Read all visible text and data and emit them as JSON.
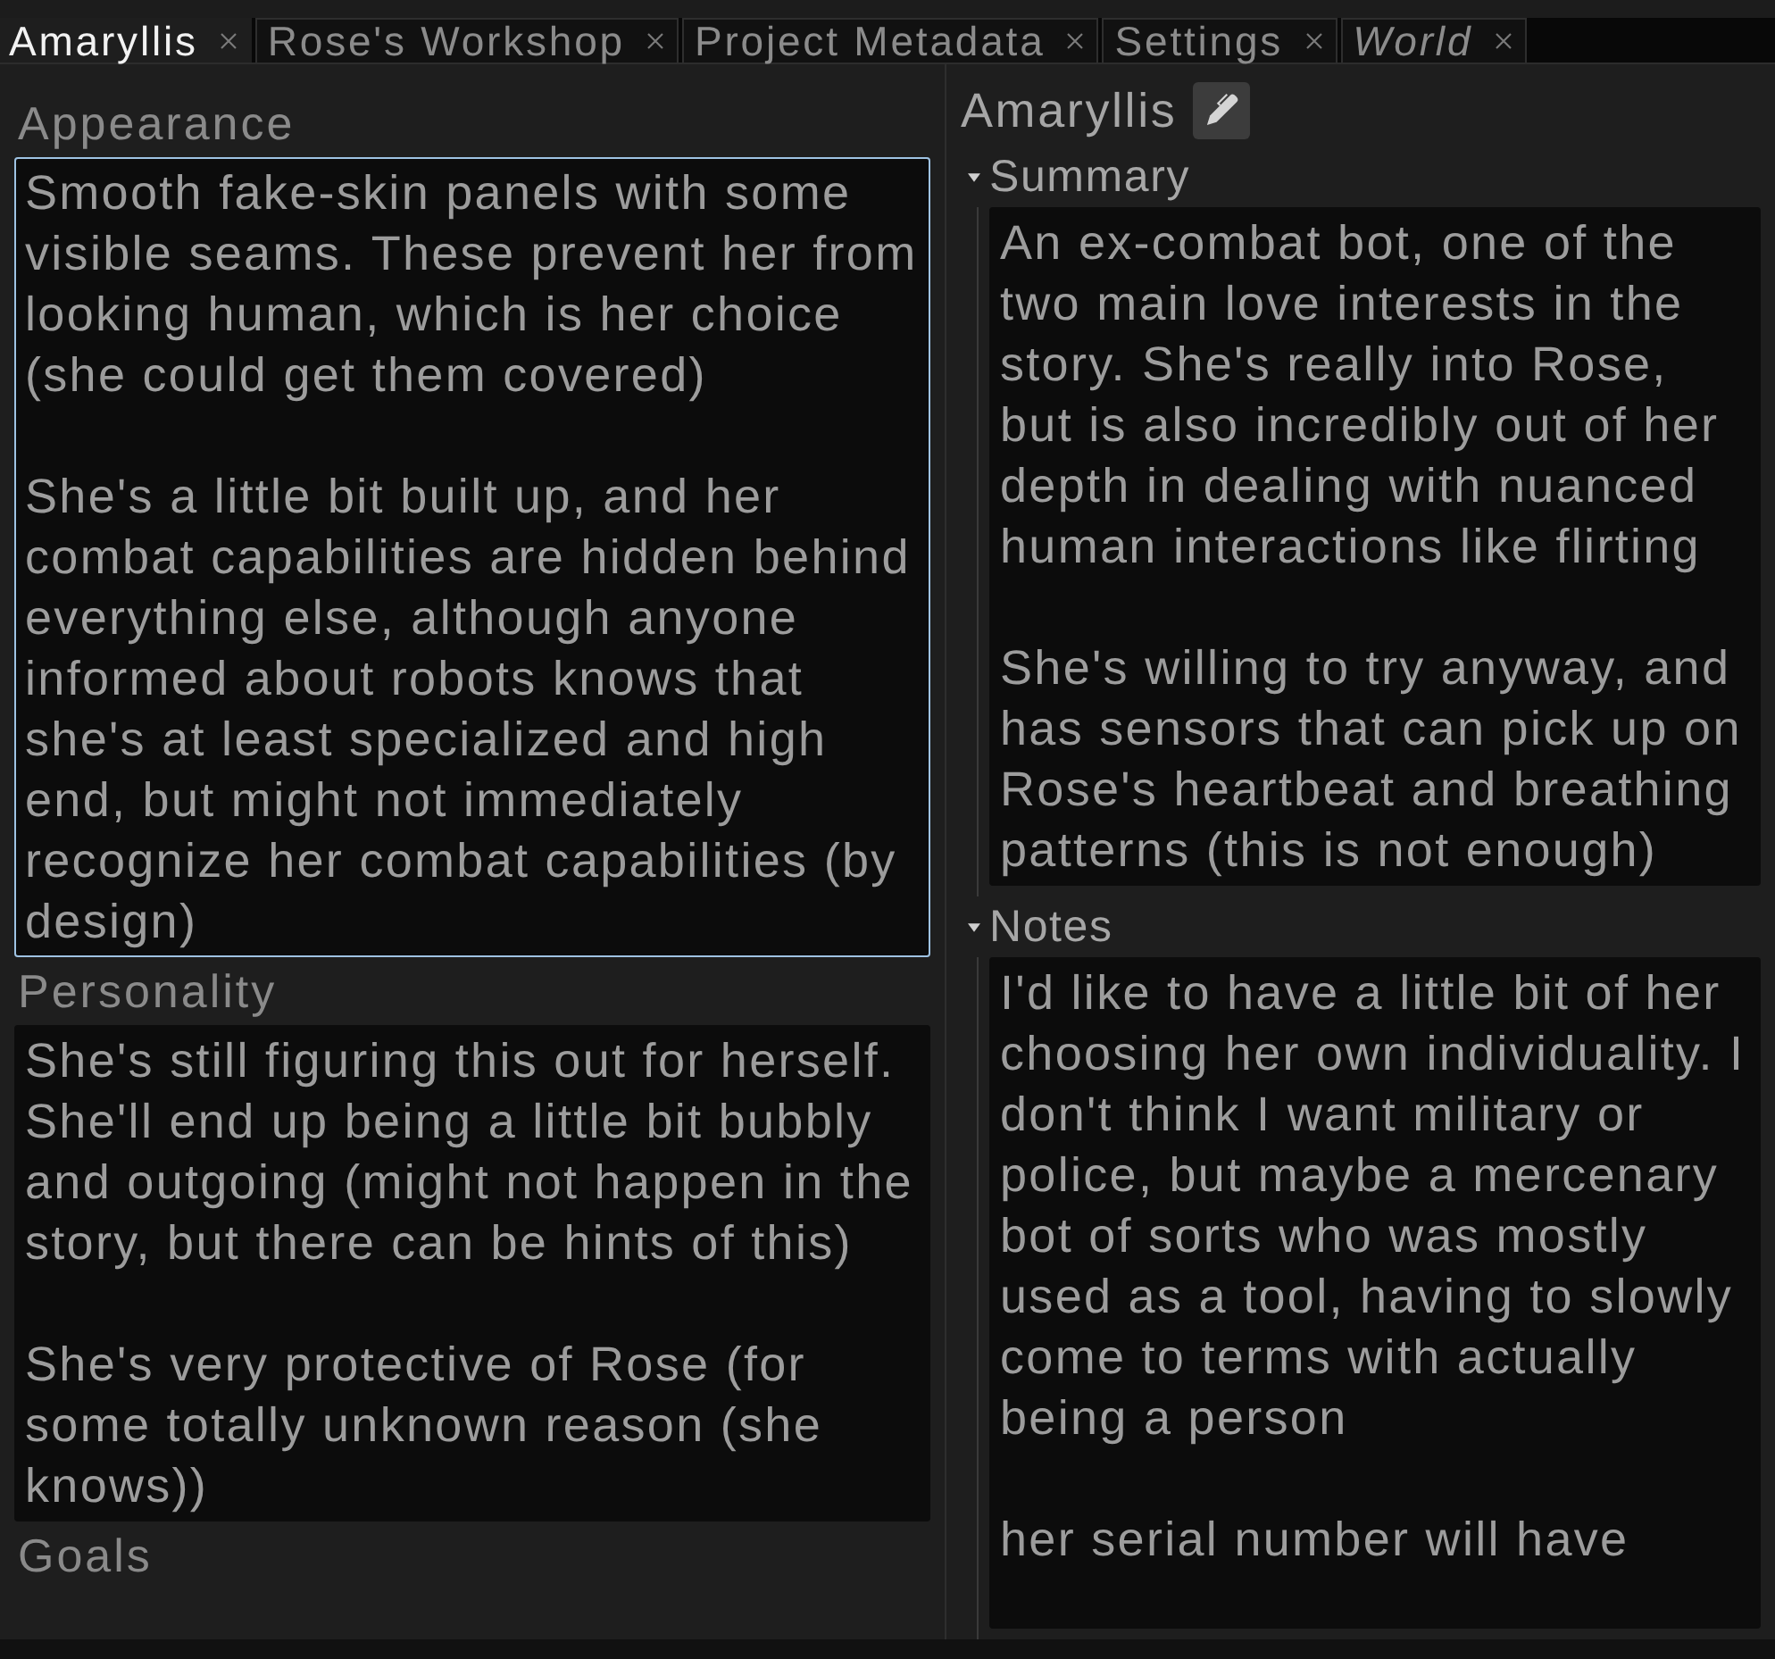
{
  "tabs": [
    {
      "label": "Amaryllis",
      "selected": true,
      "italic": false
    },
    {
      "label": "Rose's Workshop",
      "selected": false,
      "italic": false
    },
    {
      "label": "Project Metadata",
      "selected": false,
      "italic": false
    },
    {
      "label": "Settings",
      "selected": false,
      "italic": false
    },
    {
      "label": "World",
      "selected": false,
      "italic": true
    }
  ],
  "left_panel": {
    "fields": [
      {
        "label": "Appearance",
        "focused": true,
        "value": "Smooth fake-skin panels with some visible seams. These prevent her from looking human, which is her choice (she could get them covered)\n\nShe's a little bit built up, and her combat capabilities are hidden behind everything else, although anyone informed about robots knows that she's at least specialized and high end, but might not immediately recognize her combat capabilities (by design)"
      },
      {
        "label": "Personality",
        "focused": false,
        "value": "She's still figuring this out for herself. She'll end up being a little bit bubbly and outgoing (might not happen in the story, but there can be hints of this)\n\nShe's very protective of Rose (for some totally unknown reason (she knows))"
      },
      {
        "label": "Goals"
      }
    ]
  },
  "right_panel": {
    "title": "Amaryllis",
    "sections": [
      {
        "label": "Summary",
        "expanded": true,
        "value": "An ex-combat bot, one of the two main love interests in the story. She's really into Rose, but is also incredibly out of her depth in dealing with nuanced human interactions like flirting\n\nShe's willing to try anyway, and has sensors that can pick up on Rose's heartbeat and breathing patterns (this is not enough)"
      },
      {
        "label": "Notes",
        "expanded": true,
        "value": "I'd like to have a little bit of her choosing her own individuality. I don't think I want military or police, but maybe a mercenary bot of sorts who was mostly used as a tool, having to slowly come to terms with actually being a person\n\nher serial number will have"
      }
    ]
  }
}
